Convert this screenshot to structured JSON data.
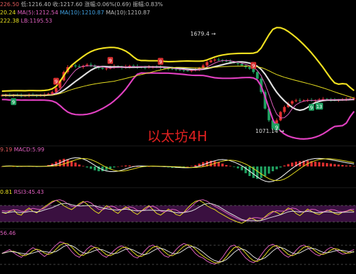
{
  "header": {
    "main_line1": {
      "parts": [
        {
          "text": "226.50",
          "color": "#e05a5a"
        },
        {
          "text": "低:1216.40",
          "color": "#bbbbbb"
        },
        {
          "text": "收:1217.60",
          "color": "#bbbbbb"
        },
        {
          "text": "涨幅:0.06%(0.69)",
          "color": "#bbbbbb"
        },
        {
          "text": "振幅:0.83%",
          "color": "#bbbbbb"
        }
      ]
    },
    "main_line2": {
      "parts": [
        {
          "text": "20.24",
          "color": "#e8e020"
        },
        {
          "text": "MA(5):1212.54",
          "color": "#e060c0"
        },
        {
          "text": "MA(10):1210.87",
          "color": "#40a0e0"
        },
        {
          "text": "MA(10):1210.87",
          "color": "#bbbbbb"
        }
      ]
    },
    "main_line3": {
      "parts": [
        {
          "text": "222.38",
          "color": "#e8e020"
        },
        {
          "text": "LB:1195.53",
          "color": "#e060c0"
        }
      ]
    },
    "macd": {
      "parts": [
        {
          "text": "9.19",
          "color": "#e05a5a"
        },
        {
          "text": "MACD:5.99",
          "color": "#e060c0"
        }
      ]
    },
    "rsi": {
      "parts": [
        {
          "text": "0.81",
          "color": "#e8e020"
        },
        {
          "text": "RSI3:45.43",
          "color": "#e060c0"
        }
      ]
    },
    "kdj": {
      "parts": [
        {
          "text": "56.46",
          "color": "#e060c0"
        }
      ]
    }
  },
  "annotations": {
    "watermark": "以太坊4H",
    "high_label": "1679.4 →",
    "low_label": "1071.14 →"
  },
  "markers": [
    {
      "label": "9",
      "type": "sell",
      "x_index": 14
    },
    {
      "label": "9",
      "type": "sell",
      "x_index": 28
    },
    {
      "label": "9",
      "type": "sell",
      "x_index": 41
    },
    {
      "label": "9",
      "type": "sell",
      "x_index": 65
    },
    {
      "label": "9",
      "type": "buy",
      "x_index": 3
    },
    {
      "label": "9",
      "type": "buy",
      "x_index": 71
    },
    {
      "label": "9",
      "type": "buy",
      "x_index": 80
    },
    {
      "label": "13",
      "type": "buy",
      "x_index": 82
    }
  ],
  "colors": {
    "up": "#e03030",
    "down": "#20a060",
    "ma_white": "#e0e0e0",
    "ma_pink": "#e060c0",
    "ma_yellow": "#e8e020",
    "boll_upper": "#f0e020",
    "boll_lower": "#e040c0",
    "macd_dif": "#ffffff",
    "macd_dea": "#e8e020",
    "rsi_fill": "#3a1040",
    "rsi_line": "#e8e020",
    "watermark": "#e02020",
    "sell_marker": "#d83030",
    "buy_marker": "#20a060"
  },
  "chart_data": [
    {
      "type": "candlestick",
      "title": "以太坊4H",
      "price_range": [
        1000,
        1750
      ],
      "high": 1679.4,
      "low": 1071.14,
      "close": [
        1300,
        1301,
        1298,
        1302,
        1300,
        1297,
        1299,
        1303,
        1301,
        1298,
        1300,
        1305,
        1310,
        1320,
        1345,
        1390,
        1440,
        1470,
        1480,
        1475,
        1470,
        1478,
        1485,
        1480,
        1470,
        1465,
        1460,
        1462,
        1470,
        1475,
        1470,
        1466,
        1472,
        1478,
        1475,
        1470,
        1468,
        1466,
        1470,
        1472,
        1468,
        1465,
        1462,
        1460,
        1458,
        1455,
        1452,
        1450,
        1448,
        1450,
        1455,
        1465,
        1480,
        1500,
        1510,
        1515,
        1512,
        1508,
        1505,
        1500,
        1495,
        1490,
        1480,
        1470,
        1460,
        1440,
        1400,
        1320,
        1220,
        1150,
        1100,
        1150,
        1200,
        1230,
        1250,
        1265,
        1270,
        1268,
        1270,
        1272,
        1268,
        1270,
        1275,
        1278,
        1276,
        1272,
        1270,
        1272,
        1275,
        1278,
        1280,
        1282
      ]
    },
    {
      "type": "bar",
      "name": "MACD",
      "values": [
        0,
        1,
        1,
        0,
        -1,
        0,
        1,
        1,
        0,
        -1,
        0,
        1,
        3,
        6,
        10,
        14,
        16,
        15,
        12,
        8,
        4,
        1,
        -2,
        -5,
        -8,
        -10,
        -10,
        -8,
        -5,
        -2,
        0,
        1,
        2,
        2,
        1,
        0,
        -1,
        -1,
        0,
        1,
        1,
        0,
        -1,
        -2,
        -3,
        -3,
        -2,
        -1,
        0,
        1,
        3,
        6,
        9,
        11,
        12,
        11,
        9,
        6,
        3,
        1,
        -1,
        -4,
        -8,
        -14,
        -20,
        -24,
        -26,
        -24,
        -20,
        -15,
        -10,
        -6,
        -2,
        2,
        5,
        8,
        10,
        11,
        12,
        12,
        11,
        10,
        9,
        8,
        7,
        6,
        5,
        4,
        3,
        2,
        2,
        1
      ]
    },
    {
      "type": "line",
      "name": "RSI",
      "values": [
        50,
        48,
        52,
        55,
        47,
        45,
        53,
        58,
        52,
        49,
        55,
        60,
        65,
        70,
        72,
        68,
        62,
        58,
        55,
        60,
        66,
        70,
        65,
        58,
        52,
        48,
        55,
        62,
        58,
        52,
        48,
        55,
        60,
        56,
        50,
        46,
        52,
        58,
        62,
        55,
        48,
        45,
        50,
        56,
        52,
        46,
        44,
        50,
        58,
        65,
        70,
        72,
        68,
        62,
        58,
        55,
        50,
        46,
        42,
        38,
        35,
        32,
        30,
        34,
        40,
        38,
        34,
        36,
        42,
        48,
        52,
        50,
        46,
        52,
        58,
        55,
        48,
        44,
        50,
        56,
        52,
        48,
        46,
        50,
        54,
        52,
        48,
        46,
        50,
        52,
        54,
        52
      ]
    },
    {
      "type": "line",
      "name": "KDJ",
      "values": [
        50,
        55,
        60,
        52,
        45,
        40,
        48,
        58,
        65,
        60,
        50,
        42,
        50,
        62,
        72,
        80,
        78,
        68,
        55,
        45,
        40,
        50,
        62,
        70,
        66,
        55,
        45,
        40,
        48,
        58,
        66,
        70,
        64,
        52,
        42,
        38,
        46,
        58,
        68,
        72,
        66,
        54,
        44,
        40,
        48,
        60,
        70,
        76,
        72,
        62,
        50,
        42,
        38,
        30,
        25,
        22,
        28,
        40,
        55,
        68,
        72,
        64,
        50,
        38,
        30,
        26,
        32,
        46,
        60,
        70,
        74,
        68,
        56,
        46,
        40,
        46,
        58,
        68,
        72,
        66,
        56,
        48,
        44,
        50,
        60,
        66,
        62,
        54,
        48,
        50,
        56,
        60
      ]
    }
  ]
}
